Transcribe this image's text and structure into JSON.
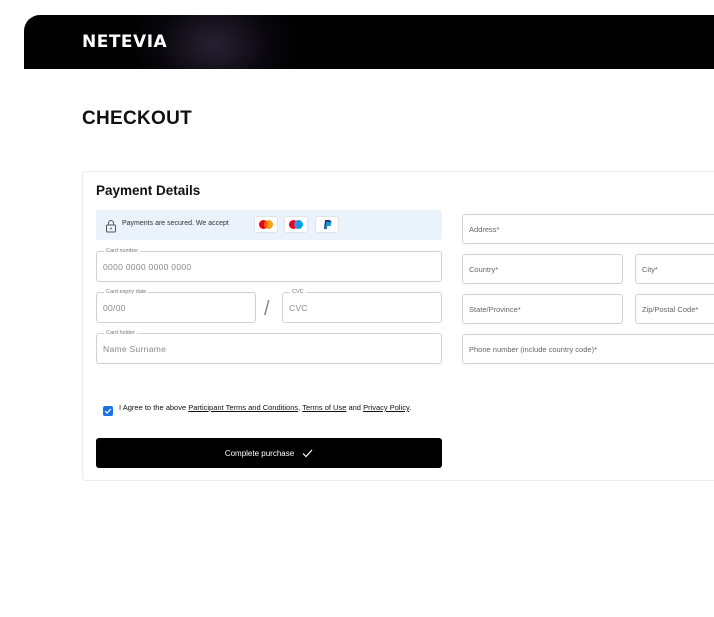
{
  "header": {
    "logo": "NETEVIA"
  },
  "page": {
    "title": "CHECKOUT"
  },
  "payment": {
    "section_title": "Payment Details",
    "secure_text": "Payments are secured.  We accept",
    "payment_methods": [
      "mastercard-icon",
      "maestro-icon",
      "paypal-icon"
    ],
    "card_number": {
      "label": "Card number",
      "placeholder": "0000 0000 0000 0000"
    },
    "expiry": {
      "label": "Card expiry date",
      "placeholder": "00/00"
    },
    "separator": "/",
    "cvc": {
      "label": "CVC",
      "placeholder": "CVC"
    },
    "holder": {
      "label": "Card holder",
      "placeholder": "Name Surname"
    }
  },
  "address": {
    "address_placeholder": "Address*",
    "country_placeholder": "Country*",
    "city_placeholder": "City*",
    "state_placeholder": "State/Province*",
    "zip_placeholder": "Zip/Postal Code*",
    "phone_placeholder": "Phone number (include country code)*"
  },
  "agree": {
    "prefix": "I Agree to the above ",
    "link1": "Participant Terms and Conditions",
    "sep1": ", ",
    "link2": "Terms of Use",
    "sep2": " and ",
    "link3": "Privacy Policy",
    "suffix": "."
  },
  "cta": {
    "label": "Complete purchase"
  },
  "colors": {
    "header_bg": "#000000",
    "banner_bg": "#eaf2fb",
    "accent": "#1a73e8",
    "button_bg": "#000000"
  }
}
